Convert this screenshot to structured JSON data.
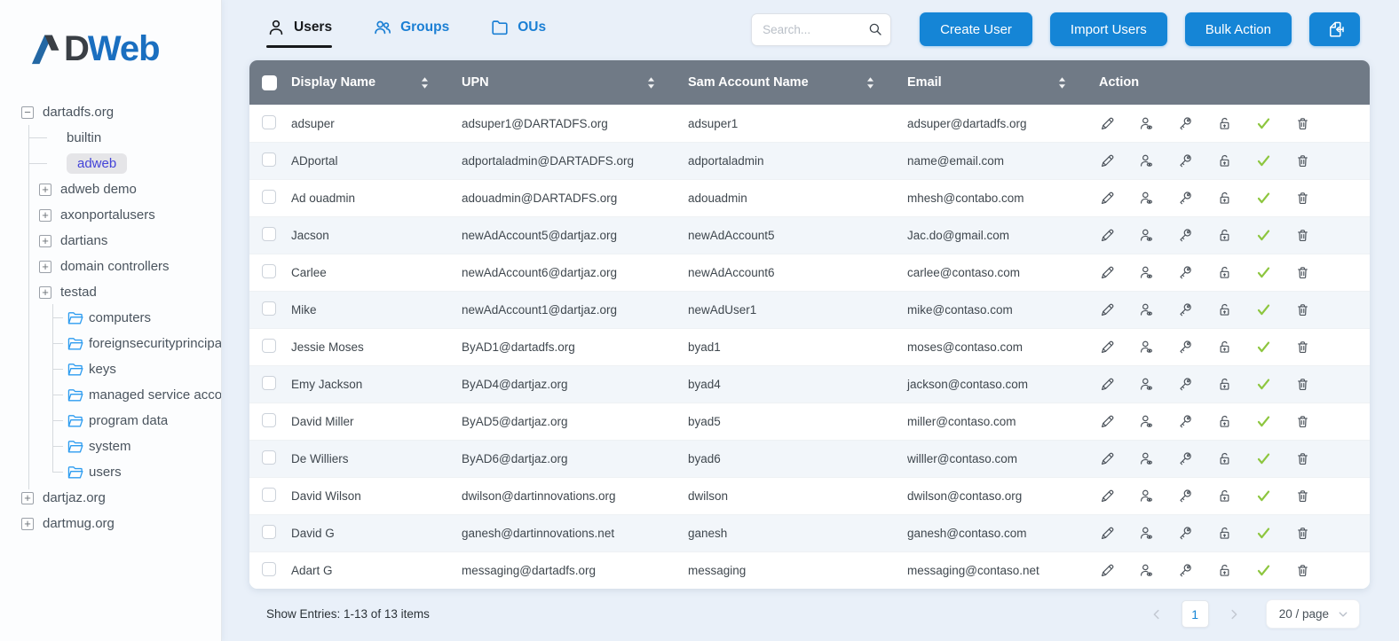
{
  "logo": {
    "mark": "A",
    "letter": "D",
    "suffix": "Web"
  },
  "sidebar": {
    "tree": [
      {
        "label": "dartadfs.org",
        "level": 0,
        "expander": "minus",
        "icon": null,
        "connector": false,
        "selected": false
      },
      {
        "label": "builtin",
        "level": 1,
        "expander": null,
        "icon": null,
        "connector": true,
        "selected": false
      },
      {
        "label": "adweb",
        "level": 1,
        "expander": null,
        "icon": null,
        "connector": true,
        "selected": true
      },
      {
        "label": "adweb demo",
        "level": 1,
        "expander": "plus",
        "icon": null,
        "connector": false,
        "selected": false
      },
      {
        "label": "axonportalusers",
        "level": 1,
        "expander": "plus",
        "icon": null,
        "connector": false,
        "selected": false
      },
      {
        "label": "dartians",
        "level": 1,
        "expander": "plus",
        "icon": null,
        "connector": false,
        "selected": false
      },
      {
        "label": "domain controllers",
        "level": 1,
        "expander": "plus",
        "icon": null,
        "connector": false,
        "selected": false
      },
      {
        "label": "testad",
        "level": 1,
        "expander": "plus",
        "icon": null,
        "connector": false,
        "selected": false
      },
      {
        "label": "computers",
        "level": 2,
        "expander": null,
        "icon": "folder",
        "connector": true,
        "selected": false
      },
      {
        "label": "foreignsecurityprincipa",
        "level": 2,
        "expander": null,
        "icon": "folder",
        "connector": true,
        "selected": false
      },
      {
        "label": "keys",
        "level": 2,
        "expander": null,
        "icon": "folder",
        "connector": true,
        "selected": false
      },
      {
        "label": "managed service accou",
        "level": 2,
        "expander": null,
        "icon": "folder",
        "connector": true,
        "selected": false
      },
      {
        "label": "program data",
        "level": 2,
        "expander": null,
        "icon": "folder",
        "connector": true,
        "selected": false
      },
      {
        "label": "system",
        "level": 2,
        "expander": null,
        "icon": "folder",
        "connector": true,
        "selected": false
      },
      {
        "label": "users",
        "level": 2,
        "expander": null,
        "icon": "folder",
        "connector": true,
        "selected": false
      },
      {
        "label": "dartjaz.org",
        "level": 0,
        "expander": "plus",
        "icon": null,
        "connector": false,
        "selected": false
      },
      {
        "label": "dartmug.org",
        "level": 0,
        "expander": "plus",
        "icon": null,
        "connector": false,
        "selected": false
      }
    ]
  },
  "header": {
    "tabs": [
      {
        "label": "Users",
        "icon": "user-icon",
        "active": true
      },
      {
        "label": "Groups",
        "icon": "users-group-icon",
        "active": false
      },
      {
        "label": "OUs",
        "icon": "folder-icon",
        "active": false
      }
    ],
    "search_placeholder": "Search...",
    "search_value": "",
    "buttons": [
      {
        "label": "Create User"
      },
      {
        "label": "Import Users"
      },
      {
        "label": "Bulk Action"
      }
    ],
    "icon_button": "file-import-icon"
  },
  "table": {
    "select_all_checked": false,
    "columns": [
      {
        "label": "Display Name",
        "sortable": true
      },
      {
        "label": "UPN",
        "sortable": true
      },
      {
        "label": "Sam Account Name",
        "sortable": true
      },
      {
        "label": "Email",
        "sortable": true
      },
      {
        "label": "Action",
        "sortable": false
      }
    ],
    "actions": [
      "edit",
      "user-details",
      "reset-password",
      "unlock-account",
      "enabled",
      "delete"
    ],
    "rows": [
      {
        "display_name": "adsuper",
        "upn": "adsuper1@DARTADFS.org",
        "sam": "adsuper1",
        "email": "adsuper@dartadfs.org",
        "checked": false
      },
      {
        "display_name": "ADportal",
        "upn": "adportaladmin@DARTADFS.org",
        "sam": "adportaladmin",
        "email": "name@email.com",
        "checked": false
      },
      {
        "display_name": "Ad ouadmin",
        "upn": "adouadmin@DARTADFS.org",
        "sam": "adouadmin",
        "email": "mhesh@contabo.com",
        "checked": false
      },
      {
        "display_name": "Jacson",
        "upn": "newAdAccount5@dartjaz.org",
        "sam": "newAdAccount5",
        "email": "Jac.do@gmail.com",
        "checked": false
      },
      {
        "display_name": "Carlee",
        "upn": "newAdAccount6@dartjaz.org",
        "sam": "newAdAccount6",
        "email": "carlee@contaso.com",
        "checked": false
      },
      {
        "display_name": "Mike",
        "upn": "newAdAccount1@dartjaz.org",
        "sam": "newAdUser1",
        "email": "mike@contaso.com",
        "checked": false
      },
      {
        "display_name": "Jessie Moses",
        "upn": "ByAD1@dartadfs.org",
        "sam": "byad1",
        "email": "moses@contaso.com",
        "checked": false
      },
      {
        "display_name": "Emy Jackson",
        "upn": "ByAD4@dartjaz.org",
        "sam": "byad4",
        "email": "jackson@contaso.com",
        "checked": false
      },
      {
        "display_name": "David Miller",
        "upn": "ByAD5@dartjaz.org",
        "sam": "byad5",
        "email": "miller@contaso.com",
        "checked": false
      },
      {
        "display_name": "De Williers",
        "upn": "ByAD6@dartjaz.org",
        "sam": "byad6",
        "email": "willler@contaso.com",
        "checked": false
      },
      {
        "display_name": "David Wilson",
        "upn": "dwilson@dartinnovations.org",
        "sam": "dwilson",
        "email": "dwilson@contaso.org",
        "checked": false
      },
      {
        "display_name": "David G",
        "upn": "ganesh@dartinnovations.net",
        "sam": "ganesh",
        "email": "ganesh@contaso.com",
        "checked": false
      },
      {
        "display_name": "Adart G",
        "upn": "messaging@dartadfs.org",
        "sam": "messaging",
        "email": "messaging@contaso.net",
        "checked": false
      }
    ]
  },
  "footer": {
    "entries_text": "Show Entries: 1-13 of 13 items",
    "current_page": "1",
    "page_size": "20 / page"
  },
  "colors": {
    "accent_blue": "#1585d6",
    "tab_blue": "#1b7fd4",
    "table_header_gray": "#707a86",
    "row_alt": "#f2f6fa",
    "check_green": "#8dc63f",
    "selected_tree_text": "#4343d8",
    "selected_tree_bg": "#e5e5e8",
    "page_bg": "#e9f0f9",
    "folder_blue": "#2d9cf0"
  }
}
